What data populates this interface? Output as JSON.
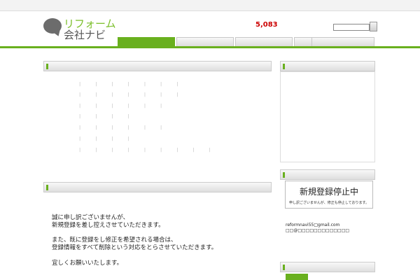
{
  "header": {
    "tagline": "",
    "sitemap_label": "",
    "logo_line1": "リフォーム",
    "logo_line2": "会社ナビ",
    "count_label": "",
    "count_value": "5,083",
    "search_value": ""
  },
  "nav": {
    "tabs": [
      {
        "label": ""
      },
      {
        "label": ""
      },
      {
        "label": ""
      },
      {
        "label": ""
      },
      {
        "label": ""
      }
    ],
    "active_index": 0
  },
  "breadcrumb": {
    "text": "",
    "right": ""
  },
  "area_box": {
    "title": "",
    "rows": [
      {
        "label": "",
        "links": [
          "",
          "",
          "",
          "",
          "",
          "",
          ""
        ]
      },
      {
        "label": "",
        "links": [
          "",
          "",
          "",
          "",
          "",
          "",
          ""
        ]
      },
      {
        "label": "",
        "links": [
          "",
          "",
          "",
          "",
          "",
          ""
        ]
      },
      {
        "label": "",
        "links": [
          "",
          "",
          "",
          ""
        ]
      },
      {
        "label": "",
        "links": [
          "",
          "",
          "",
          "",
          "",
          ""
        ]
      },
      {
        "label": "",
        "links": [
          "",
          "",
          "",
          ""
        ]
      },
      {
        "label": "",
        "links": [
          "",
          "",
          "",
          "",
          "",
          "",
          "",
          "",
          ""
        ]
      }
    ]
  },
  "notice_box": {
    "title": "",
    "lines": [
      "誠に申し訳ございませんが、",
      "新規登録を差し控えさせていただきます。",
      "",
      "また、既に登録をし修正を希望される場合は、",
      "登録情報をすべて削除という対応をとらさせていただきます。",
      "",
      "宜しくお願いいたします。"
    ]
  },
  "sidebar": {
    "box1_title": "",
    "box2_title": "",
    "stop_title": "新規登録停止中",
    "stop_sub": "申し訳ございませんが、修正も停止しております。",
    "contact_lines": [
      "",
      "reformnavi55□gmail.com",
      "□□@□□□□□□□□□□□□□",
      "",
      "",
      ""
    ],
    "box3_title": "",
    "badge": ""
  },
  "colors": {
    "accent": "#69b01e",
    "count": "#cc0000",
    "link": "#1a4fa0"
  }
}
